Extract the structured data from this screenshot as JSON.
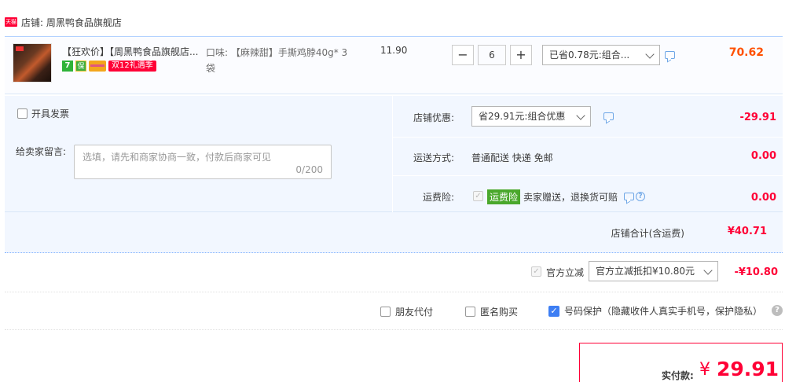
{
  "shop": {
    "logo_text": "天猫",
    "name": "店铺: 周黑鸭食品旗舰店"
  },
  "item": {
    "title": "【狂欢价】【周黑鸭食品旗舰店...",
    "promo_badge": "双12礼遇季",
    "sku": "口味: 【麻辣甜】手撕鸡脖40g* 3袋",
    "price": "11.90",
    "qty_minus": "−",
    "qty": "6",
    "qty_plus": "+",
    "discount_select": "已省0.78元:组合...",
    "subtotal": "70.62"
  },
  "invoice": {
    "label": "开具发票"
  },
  "message": {
    "label": "给卖家留言:",
    "placeholder": "选填，请先和商家协商一致，付款后商家可见",
    "count": "0/200"
  },
  "shop_discount": {
    "label": "店铺优惠:",
    "select": "省29.91元:组合优惠",
    "value": "-29.91"
  },
  "shipping": {
    "label": "运送方式:",
    "method": "普通配送 快递 免邮",
    "value": "0.00"
  },
  "insurance": {
    "label": "运费险:",
    "badge": "运费险",
    "desc": "卖家赠送，退换货可赔",
    "value": "0.00"
  },
  "shop_total": {
    "label": "店铺合计(含运费)",
    "value": "¥40.71"
  },
  "official": {
    "label": "官方立减",
    "select": "官方立减抵扣¥10.80元",
    "value": "-¥10.80"
  },
  "options": {
    "friend_pay": "朋友代付",
    "anonymous": "匿名购买",
    "privacy": "号码保护（隐藏收件人真实手机号，保护隐私）"
  },
  "pay": {
    "label": "实付款:",
    "currency": "¥",
    "amount": "29.91"
  },
  "colors": {
    "accent_red": "#ff0036",
    "orange": "#ff5000",
    "blue_border": "#b2d1ff",
    "panel_bg": "#f2f7ff"
  }
}
